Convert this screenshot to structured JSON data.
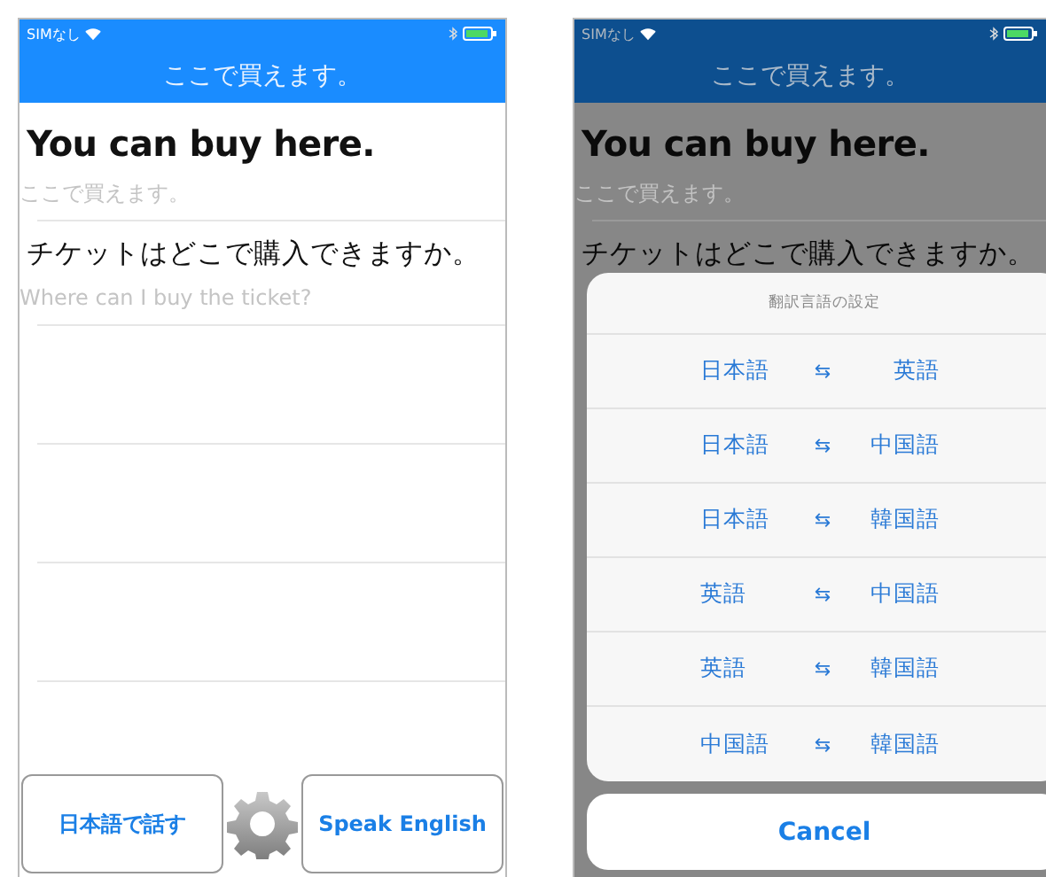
{
  "screens": [
    {
      "dimmed": false,
      "status": {
        "carrier": "SIMなし"
      },
      "title": "ここで買えます。",
      "entries": [
        {
          "kind": "main",
          "text": "You can buy here."
        },
        {
          "kind": "sub",
          "text": "ここで買えます。"
        },
        {
          "kind": "main_jp",
          "text": "チケットはどこで購入できますか。"
        },
        {
          "kind": "sub",
          "text": "Where can I buy the ticket?"
        }
      ],
      "buttons": [
        {
          "kind": "speak",
          "label": "日本語で話す"
        },
        {
          "kind": "settings"
        },
        {
          "kind": "speak",
          "label": "Speak English"
        }
      ]
    },
    {
      "dimmed": true,
      "status": {
        "carrier": "SIMなし"
      },
      "title": "ここで買えます。",
      "entries": [
        {
          "kind": "main",
          "text": "You can buy here."
        },
        {
          "kind": "sub",
          "text": "ここで買えます。"
        },
        {
          "kind": "main_jp",
          "text": "チケットはどこで購入できますか。"
        }
      ],
      "sheet": {
        "title": "翻訳言語の設定",
        "options": [
          {
            "from": "日本語",
            "arrow": "⇆",
            "to": "英語"
          },
          {
            "from": "日本語",
            "arrow": "⇆",
            "to": "中国語"
          },
          {
            "from": "日本語",
            "arrow": "⇆",
            "to": "韓国語"
          },
          {
            "from": "英語",
            "arrow": "⇆",
            "to": "中国語"
          },
          {
            "from": "英語",
            "arrow": "⇆",
            "to": "韓国語"
          },
          {
            "from": "中国語",
            "arrow": "⇆",
            "to": "韓国語"
          }
        ],
        "cancel": "Cancel"
      }
    }
  ]
}
